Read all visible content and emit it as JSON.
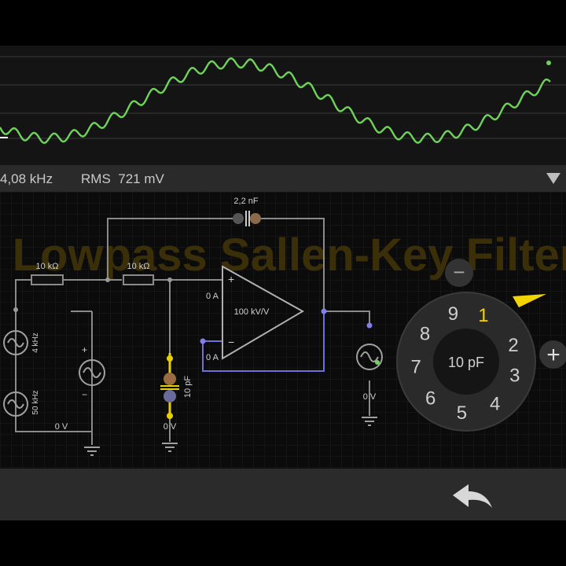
{
  "scope": {
    "trace_color": "#6fd35a"
  },
  "status": {
    "frequency": "4,08 kHz",
    "rms_label": "RMS",
    "rms_value": "721 mV"
  },
  "circuit": {
    "title": "Lowpass Sallen-Key Filter",
    "r1_label": "10 kΩ",
    "r2_label": "10 kΩ",
    "c1_label": "2,2 nF",
    "c2_label": "10 pF",
    "opamp_gain": "100 kV/V",
    "in_plus_current": "0 A",
    "in_minus_current": "0 A",
    "src1_label": "4 kHz",
    "src2_label": "50 kHz",
    "gnd1_label": "0 V",
    "gnd2_label": "0 V",
    "gnd3_label": "0 V",
    "plus_sign": "+",
    "minus_sign": "−"
  },
  "dial": {
    "center_value": "10 pF",
    "digits": [
      "1",
      "2",
      "3",
      "4",
      "5",
      "6",
      "7",
      "8",
      "9"
    ],
    "selected_digit": "1",
    "minus_label": "−",
    "plus_label": "+",
    "accent_color": "#f2d400"
  },
  "bottom": {
    "back_icon": "undo-arrow-icon"
  }
}
